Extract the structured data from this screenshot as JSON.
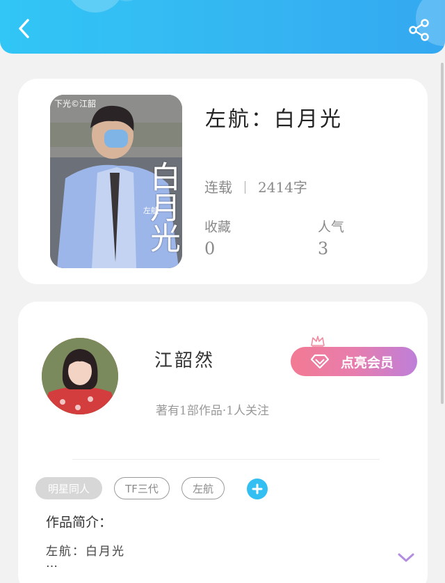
{
  "header": {
    "back_icon": "chevron-left-icon",
    "share_icon": "share-icon",
    "color": "#33b7f2"
  },
  "book": {
    "title": "左航：白月光",
    "status": "连载",
    "word_count": "2414字",
    "stats": [
      {
        "label": "收藏",
        "value": "0"
      },
      {
        "label": "人气",
        "value": "3"
      }
    ],
    "cover": {
      "top_text": "下光©江韶",
      "vertical_title": "白月光",
      "sub_text": "左航"
    }
  },
  "author": {
    "name": "江韶然",
    "info": "著有1部作品·1人关注",
    "vip_button": "点亮会员",
    "vip_icon": "diamond-icon"
  },
  "tags": [
    {
      "label": "明星同人",
      "style": "filled"
    },
    {
      "label": "TF三代",
      "style": "outline"
    },
    {
      "label": "左航",
      "style": "outline"
    }
  ],
  "intro": {
    "label": "作品简介：",
    "text": "左航：白月光",
    "ellipsis": "…"
  },
  "colors": {
    "accent": "#33bff1",
    "vip_start": "#f27a93",
    "vip_end": "#be7fd9",
    "expand": "#b28de0"
  }
}
